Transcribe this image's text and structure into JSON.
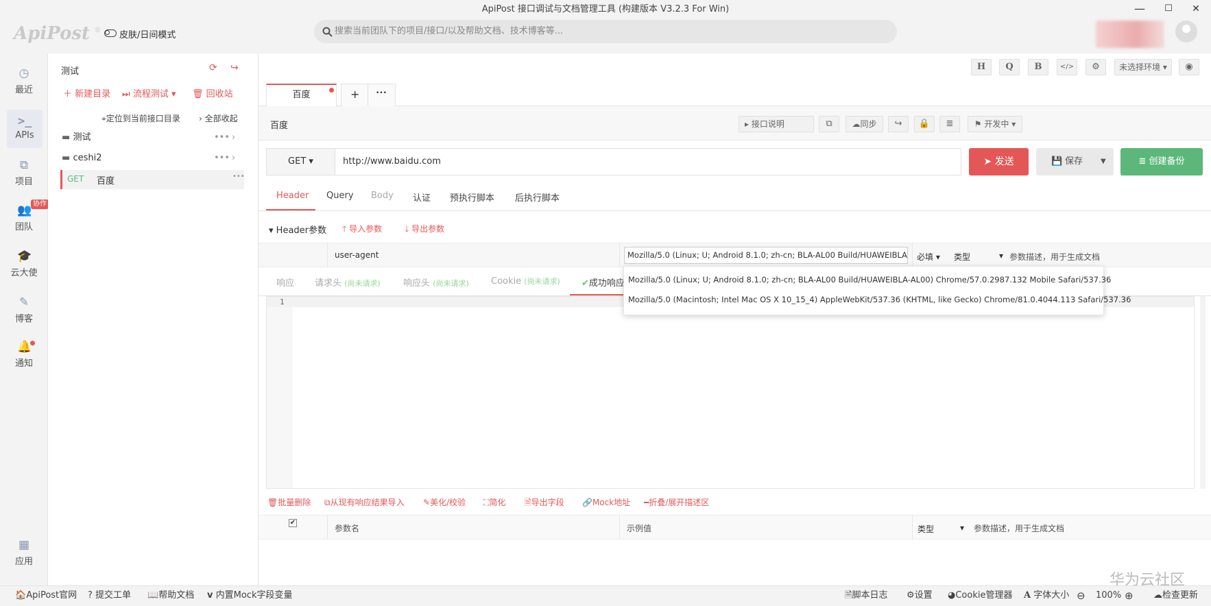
{
  "window": {
    "title": "ApiPost 接口调试与文档管理工具 (构建版本 V3.2.3 For Win)",
    "min": "—",
    "max": "☐",
    "close": "✕"
  },
  "top": {
    "logo": "ApiPost",
    "logo_mark": "®",
    "skin_label": "皮肤/日间模式",
    "search_placeholder": "搜索当前团队下的项目/接口/以及帮助文档、技术博客等..."
  },
  "nav": [
    {
      "label": "最近",
      "icon": "clock-icon"
    },
    {
      "label": "APIs",
      "icon": "terminal-icon"
    },
    {
      "label": "项目",
      "icon": "project-icon"
    },
    {
      "label": "团队",
      "icon": "team-icon",
      "badge": "协作"
    },
    {
      "label": "云大使",
      "icon": "graduation-cap-icon"
    },
    {
      "label": "博客",
      "icon": "edit-icon"
    },
    {
      "label": "通知",
      "icon": "bell-icon"
    },
    {
      "label": "应用",
      "icon": "apps-icon"
    }
  ],
  "tree": {
    "title": "测试",
    "new_dir": "新建目录",
    "flow_test": "流程测试",
    "recycle": "回收站",
    "locate": "定位到当前接口目录",
    "collapse_all": "全部收起",
    "folders": [
      "测试",
      "ceshi2"
    ],
    "api": {
      "method": "GET",
      "name": "百度"
    }
  },
  "toolbar": {
    "h": "H",
    "q": "Q",
    "b": "B",
    "code": "</>",
    "settings": "⚙",
    "env": "未选择环境",
    "eye": "◉"
  },
  "tabs": {
    "active": "百度",
    "add": "+",
    "more": "•••"
  },
  "request": {
    "name": "百度",
    "doc_btn": "接口说明",
    "sync_btn": "同步",
    "status_btn": "开发中",
    "method": "GET",
    "url": "http://www.baidu.com",
    "send": "发送",
    "save": "保存",
    "backup": "创建备份"
  },
  "req_tabs": [
    "Header",
    "Query",
    "Body",
    "认证",
    "预执行脚本",
    "后执行脚本"
  ],
  "header_section": {
    "title": "Header参数",
    "import": "导入参数",
    "export": "导出参数"
  },
  "header_row": {
    "key": "user-agent",
    "value": "Mozilla/5.0 (Linux; U; Android 8.1.0; zh-cn; BLA-AL00 Build/HUAWEIBLA-AL",
    "required": "必填",
    "type": "类型",
    "desc": "参数描述，用于生成文档"
  },
  "suggestions": [
    "Mozilla/5.0 (Linux; U; Android 8.1.0; zh-cn; BLA-AL00 Build/HUAWEIBLA-AL00) Chrome/57.0.2987.132 Mobile Safari/537.36",
    "Mozilla/5.0 (Macintosh; Intel Mac OS X 10_15_4) AppleWebKit/537.36 (KHTML, like Gecko) Chrome/81.0.4044.113 Safari/537.36"
  ],
  "resp_tabs": {
    "response": "响应",
    "req_header": "请求头",
    "resp_header": "响应头",
    "cookie": "Cookie",
    "not_requested": "(尚未请求)",
    "success": "成功响应"
  },
  "editor": {
    "line": "1"
  },
  "actions": [
    "批量删除",
    "从现有响应结果导入",
    "美化/校验",
    "简化",
    "导出字段",
    "Mock地址",
    "折叠/展开描述区"
  ],
  "param_table": {
    "name": "参数名",
    "example": "示例值",
    "type": "类型",
    "desc": "参数描述，用于生成文档",
    "check": "✔"
  },
  "status": {
    "official": "ApiPost官网",
    "ticket": "提交工单",
    "help": "帮助文档",
    "mock": "内置Mock字段变量",
    "script_log": "脚本日志",
    "settings": "设置",
    "cookie": "Cookie管理器",
    "font": "字体大小",
    "zoom": "100%",
    "update": "检查更新"
  },
  "watermark": "华为云社区",
  "colors": {
    "accent": "#e45757",
    "green": "#5cb87a",
    "blue": "#4a90e2"
  }
}
